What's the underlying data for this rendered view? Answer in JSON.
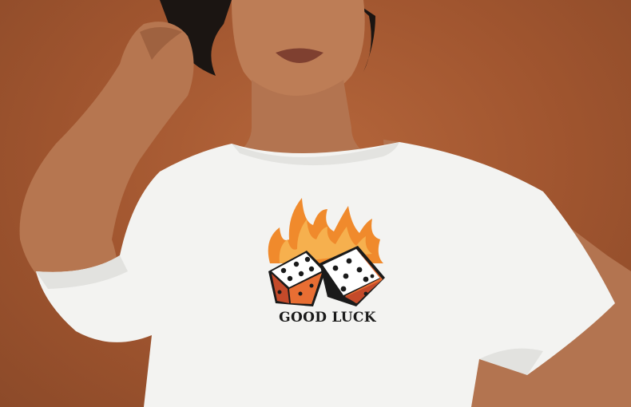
{
  "photo": {
    "subject": "woman-wearing-white-tshirt",
    "background_color": "#a55a33",
    "shirt_color": "#f3f3f1",
    "skin_color": "#b97a55",
    "hair_color": "#1b1512"
  },
  "shirt_print": {
    "text": "GOOD LUCK",
    "icon": "flaming-dice-icon",
    "flame_color": "#f08a2c",
    "die_color": "#ffffff",
    "die_shadow_color": "#c44a2a"
  }
}
